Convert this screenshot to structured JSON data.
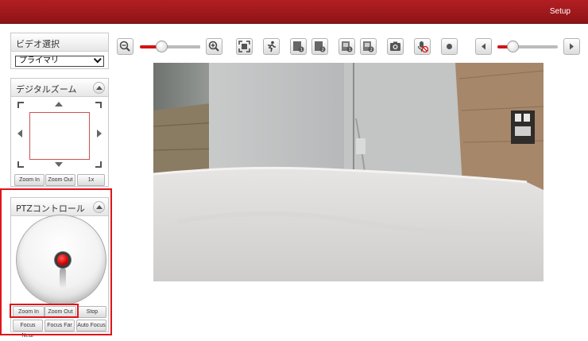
{
  "header": {
    "setup_label": "Setup"
  },
  "video_select": {
    "title": "ビデオ選択",
    "selected": "プライマリ"
  },
  "digital_zoom": {
    "title": "デジタルズーム",
    "buttons": [
      "Zoom In",
      "Zoom Out",
      "1x"
    ]
  },
  "ptz": {
    "title": "PTZコントロール",
    "row1": [
      "Zoom In",
      "Zoom Out",
      "Stop"
    ],
    "row2": [
      "Focus Near",
      "Focus Far",
      "Auto Focus"
    ]
  },
  "toolbar": {
    "icons": [
      "zoom-out-icon",
      "zoom-in-icon",
      "fit-screen-icon",
      "motion-icon",
      "stream1-icon",
      "stream2-icon",
      "record1-icon",
      "record2-icon",
      "snapshot-icon",
      "mic-mute-icon",
      "record-icon",
      "prev-icon",
      "next-icon"
    ],
    "zoom_slider_level": 0.35,
    "volume_slider_level": 0.2
  },
  "colors": {
    "brand": "#a81b1f",
    "highlight": "#e0141a"
  }
}
